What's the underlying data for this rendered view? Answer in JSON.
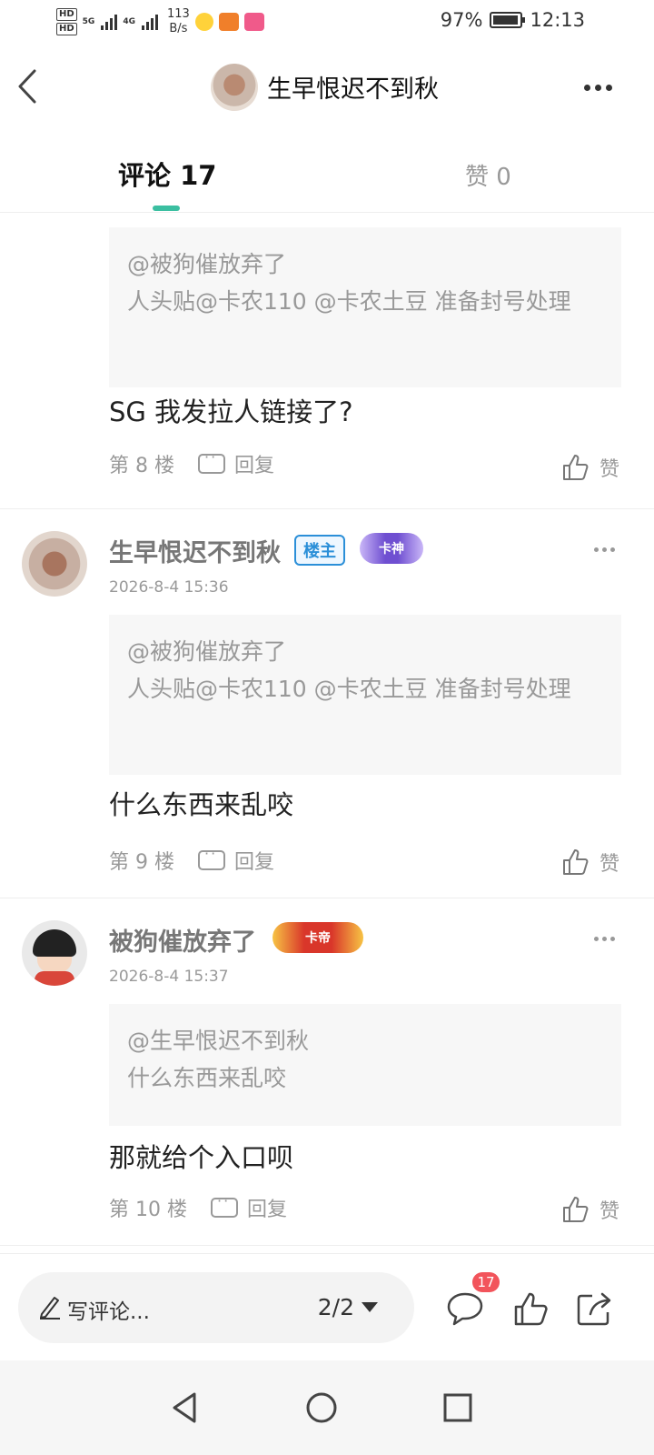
{
  "status_bar": {
    "network_1": "5G",
    "network_2": "4G",
    "speed_value": "113",
    "speed_unit": "B/s",
    "battery": "97%",
    "time": "12:13",
    "hd_label": "HD"
  },
  "header": {
    "title": "生早恨迟不到秋"
  },
  "tabs": [
    {
      "label": "评论 17",
      "active": true
    },
    {
      "label": "赞 0",
      "active": false
    }
  ],
  "comments": [
    {
      "quote_user": "@被狗催放弃了",
      "quote_text": "  人头贴@卡农110 @卡农土豆 准备封号处理",
      "text": "SG 我发拉人链接了?",
      "floor": "第 8 楼",
      "reply_label": "回复",
      "like_label": "赞"
    },
    {
      "username": "生早恨迟不到秋",
      "owner_tag": "楼主",
      "badge": "卡神",
      "timestamp": "2026-8-4 15:36",
      "quote_user": "@被狗催放弃了",
      "quote_text": "  人头贴@卡农110 @卡农土豆 准备封号处理",
      "text": "什么东西来乱咬",
      "floor": "第 9 楼",
      "reply_label": "回复",
      "like_label": "赞"
    },
    {
      "username": "被狗催放弃了",
      "badge": "卡帝",
      "timestamp": "2026-8-4 15:37",
      "quote_user": "@生早恨迟不到秋",
      "quote_text": "什么东西来乱咬",
      "text": "那就给个入口呗",
      "floor": "第 10 楼",
      "reply_label": "回复",
      "like_label": "赞"
    }
  ],
  "bottom_bar": {
    "placeholder": "写评论...",
    "page_indicator": "2/2",
    "comment_count": "17"
  },
  "colors": {
    "accent": "#3bbfa1",
    "owner_tag": "#2b8fd8",
    "badge_red": "#f2545b"
  }
}
